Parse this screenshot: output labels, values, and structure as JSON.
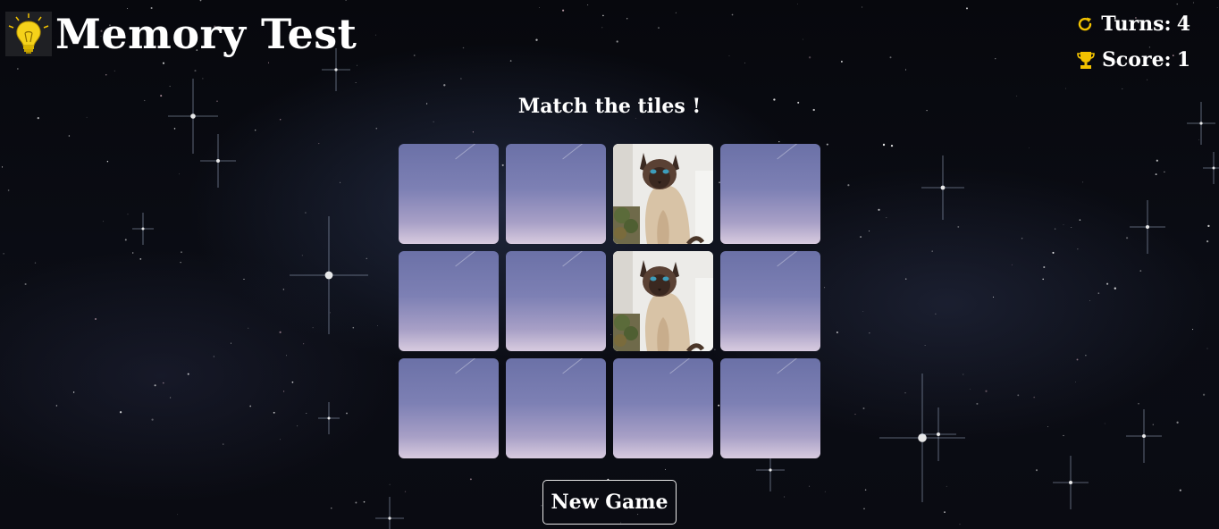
{
  "header": {
    "title": "Memory Test",
    "logo_icon": "lightbulb-icon"
  },
  "stats": {
    "turns_label": "Turns:",
    "turns_value": "4",
    "score_label": "Score:",
    "score_value": "1",
    "accent_color": "#f2c200"
  },
  "board": {
    "instruction": "Match the tiles !",
    "rows": 3,
    "columns": 4,
    "tiles": [
      {
        "state": "hidden"
      },
      {
        "state": "hidden"
      },
      {
        "state": "revealed",
        "image": "siamese-cat"
      },
      {
        "state": "hidden"
      },
      {
        "state": "hidden"
      },
      {
        "state": "hidden"
      },
      {
        "state": "revealed",
        "image": "siamese-cat"
      },
      {
        "state": "hidden"
      },
      {
        "state": "hidden"
      },
      {
        "state": "hidden"
      },
      {
        "state": "hidden"
      },
      {
        "state": "hidden"
      }
    ]
  },
  "controls": {
    "new_game_label": "New Game"
  }
}
